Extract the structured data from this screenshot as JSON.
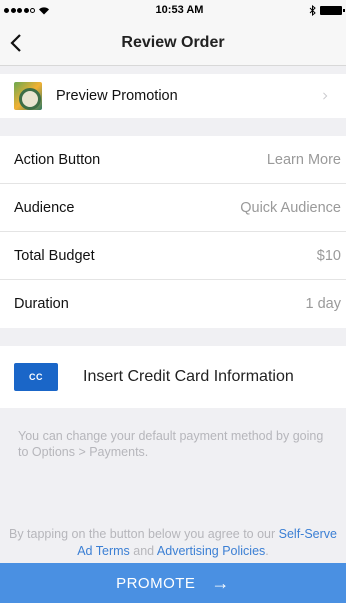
{
  "status_bar": {
    "time": "10:53 AM"
  },
  "nav": {
    "back_glyph": "<",
    "title": "Review Order"
  },
  "promotion": {
    "label": "Preview Promotion",
    "chevron": ">"
  },
  "details": [
    {
      "label": "Action Button",
      "value": "Learn More"
    },
    {
      "label": "Audience",
      "value": "Quick Audience"
    },
    {
      "label": "Total Budget",
      "value": "$10"
    },
    {
      "label": "Duration",
      "value": "1 day"
    }
  ],
  "payment": {
    "badge": "CC",
    "label": "Insert Credit Card Information",
    "info": "You can change your default payment method by going to Options > Payments."
  },
  "terms": {
    "prefix": "By tapping on the button below you agree to our ",
    "link1": "Self-Serve Ad Terms",
    "middle": " and ",
    "link2": "Advertising Policies",
    "suffix": "."
  },
  "promote": {
    "label": "PROMOTE",
    "arrow": "→"
  },
  "colors": {
    "accent": "#4a90e2",
    "link": "#3b7fd4",
    "cc_badge": "#1a66c8"
  }
}
